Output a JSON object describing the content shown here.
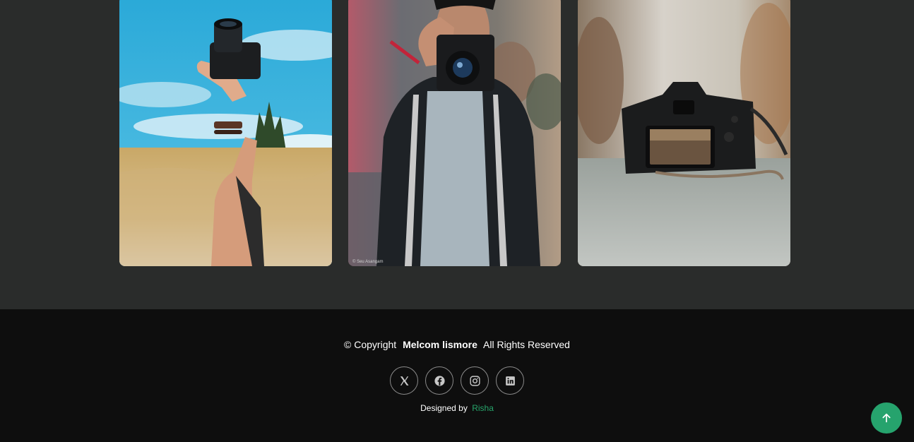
{
  "gallery": {
    "photo_credit": "© Seu Asangam"
  },
  "footer": {
    "copyright_prefix": "© Copyright",
    "brand_name": "Melcom lismore",
    "rights_text": "All Rights Reserved",
    "socials": [
      {
        "icon": "x-twitter-icon"
      },
      {
        "icon": "facebook-icon"
      },
      {
        "icon": "instagram-icon"
      },
      {
        "icon": "linkedin-icon"
      }
    ],
    "designed_by_label": "Designed by",
    "designer_name": "Risha"
  },
  "colors": {
    "section_bg": "#2a2c2b",
    "footer_bg": "#0e0e0e",
    "accent_green": "#26a36d"
  },
  "scroll_top": {
    "icon": "arrow-up-icon"
  }
}
